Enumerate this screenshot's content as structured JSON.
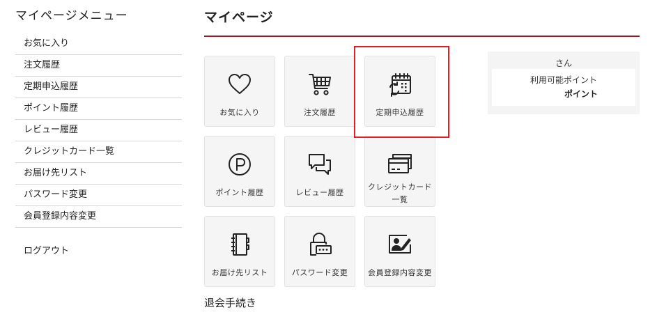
{
  "sidebar": {
    "title": "マイページメニュー",
    "items": [
      {
        "label": "お気に入り"
      },
      {
        "label": "注文履歴"
      },
      {
        "label": "定期申込履歴"
      },
      {
        "label": "ポイント履歴"
      },
      {
        "label": "レビュー履歴"
      },
      {
        "label": "クレジットカード一覧"
      },
      {
        "label": "お届け先リスト"
      },
      {
        "label": "パスワード変更"
      },
      {
        "label": "会員登録内容変更"
      }
    ],
    "logout": "ログアウト"
  },
  "main": {
    "title": "マイページ",
    "tiles": [
      {
        "label": "お気に入り",
        "icon": "heart-icon"
      },
      {
        "label": "注文履歴",
        "icon": "cart-icon"
      },
      {
        "label": "定期申込履歴",
        "icon": "calendar-refresh-icon"
      },
      {
        "label": "ポイント履歴",
        "icon": "point-icon"
      },
      {
        "label": "レビュー履歴",
        "icon": "chat-icon"
      },
      {
        "label": "クレジットカード",
        "label2": "一覧",
        "icon": "credit-card-icon"
      },
      {
        "label": "お届け先リスト",
        "icon": "address-book-icon"
      },
      {
        "label": "パスワード変更",
        "icon": "lock-icon"
      },
      {
        "label": "会員登録内容変更",
        "icon": "profile-edit-icon"
      }
    ],
    "withdraw": "退会手続き"
  },
  "points": {
    "name_suffix": "さん",
    "available_label": "利用可能ポイント",
    "unit": "ポイント"
  },
  "colors": {
    "accent_rule": "#8a1f2d",
    "highlight": "#e02020",
    "tile_bg": "#f5f5f5"
  }
}
